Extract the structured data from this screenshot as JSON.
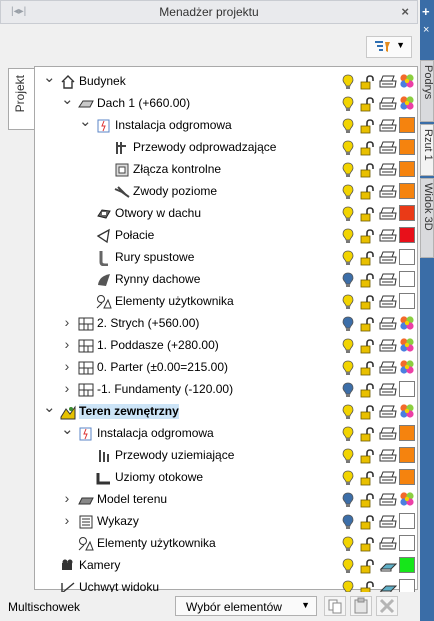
{
  "window": {
    "title": "Menadżer projektu"
  },
  "toolbar": {
    "filter_icon": "filter-icon",
    "dropdown_arrow": "▼"
  },
  "left_tab": {
    "label": "Projekt"
  },
  "right_tabs": [
    {
      "label": "Podrys"
    },
    {
      "label": "Rzut 1"
    },
    {
      "label": "Widok 3D"
    }
  ],
  "tree": {
    "rows": [
      {
        "label": "Budynek",
        "level": 0,
        "expand": "open",
        "icon": "house-icon",
        "bulb": "yellow",
        "print": "printer",
        "color": "multi"
      },
      {
        "label": "Dach 1 (+660.00)",
        "level": 1,
        "expand": "open",
        "icon": "roof-icon",
        "bulb": "yellow",
        "print": "printer",
        "color": "multi"
      },
      {
        "label": "Instalacja odgromowa",
        "level": 2,
        "expand": "open",
        "icon": "lightning-install-icon",
        "bulb": "yellow",
        "print": "printer",
        "color": "#f5830e"
      },
      {
        "label": "Przewody odprowadzające",
        "level": 3,
        "expand": "none",
        "icon": "down-conductor-icon",
        "bulb": "yellow",
        "print": "printer",
        "color": "#f5830e"
      },
      {
        "label": "Złącza kontrolne",
        "level": 3,
        "expand": "none",
        "icon": "test-joint-icon",
        "bulb": "yellow",
        "print": "printer",
        "color": "#f5830e"
      },
      {
        "label": "Zwody poziome",
        "level": 3,
        "expand": "none",
        "icon": "horizontal-conductor-icon",
        "bulb": "yellow",
        "print": "printer",
        "color": "#f5830e"
      },
      {
        "label": "Otwory w dachu",
        "level": 2,
        "expand": "none",
        "icon": "roof-opening-icon",
        "bulb": "yellow",
        "print": "printer",
        "color": "#ea3a17"
      },
      {
        "label": "Połacie",
        "level": 2,
        "expand": "none",
        "icon": "roof-slope-icon",
        "bulb": "yellow",
        "print": "printer",
        "color": "#e8101a"
      },
      {
        "label": "Rury spustowe",
        "level": 2,
        "expand": "none",
        "icon": "downpipe-icon",
        "bulb": "yellow",
        "print": "printer",
        "color": "#ffffff"
      },
      {
        "label": "Rynny dachowe",
        "level": 2,
        "expand": "none",
        "icon": "gutter-icon",
        "bulb": "blue",
        "print": "printer",
        "color": "#ffffff"
      },
      {
        "label": "Elementy użytkownika",
        "level": 2,
        "expand": "none",
        "icon": "user-elements-icon",
        "bulb": "yellow",
        "print": "printer",
        "color": "#ffffff"
      },
      {
        "label": "2. Strych (+560.00)",
        "level": 1,
        "expand": "closed",
        "icon": "storey-icon",
        "bulb": "blue",
        "print": "printer",
        "color": "multi"
      },
      {
        "label": "1. Poddasze (+280.00)",
        "level": 1,
        "expand": "closed",
        "icon": "storey-icon",
        "bulb": "yellow",
        "print": "printer",
        "color": "multi"
      },
      {
        "label": "0. Parter (±0.00=215.00)",
        "level": 1,
        "expand": "closed",
        "icon": "storey-icon",
        "bulb": "yellow",
        "print": "printer",
        "color": "multi"
      },
      {
        "label": "-1. Fundamenty (-120.00)",
        "level": 1,
        "expand": "closed",
        "icon": "storey-icon",
        "bulb": "blue",
        "print": "printer",
        "color": "#ffffff"
      },
      {
        "label": "Teren zewnętrzny",
        "level": 0,
        "expand": "open",
        "icon": "terrain-icon",
        "bulb": "yellow",
        "print": "printer",
        "color": "multi",
        "bold": true,
        "selected": true
      },
      {
        "label": "Instalacja odgromowa",
        "level": 1,
        "expand": "open",
        "icon": "lightning-install-icon",
        "bulb": "yellow",
        "print": "printer",
        "color": "#f5830e"
      },
      {
        "label": "Przewody uziemiające",
        "level": 2,
        "expand": "none",
        "icon": "earthing-conductor-icon",
        "bulb": "yellow",
        "print": "printer",
        "color": "#f5830e"
      },
      {
        "label": "Uziomy otokowe",
        "level": 2,
        "expand": "none",
        "icon": "ring-earth-icon",
        "bulb": "yellow",
        "print": "printer",
        "color": "#f5830e"
      },
      {
        "label": "Model terenu",
        "level": 1,
        "expand": "closed",
        "icon": "terrain-model-icon",
        "bulb": "blue",
        "print": "printer",
        "color": "multi"
      },
      {
        "label": "Wykazy",
        "level": 1,
        "expand": "closed",
        "icon": "list-icon",
        "bulb": "blue",
        "print": "printer",
        "color": "#ffffff"
      },
      {
        "label": "Elementy użytkownika",
        "level": 1,
        "expand": "none",
        "icon": "user-elements-icon",
        "bulb": "yellow",
        "print": "printer",
        "color": "#ffffff"
      },
      {
        "label": "Kamery",
        "level": 0,
        "expand": "none",
        "icon": "camera-icon",
        "bulb": "yellow",
        "print": "eraser",
        "color": "#16e61a"
      },
      {
        "label": "Uchwyt widoku",
        "level": 0,
        "expand": "none",
        "icon": "view-handle-icon",
        "bulb": "yellow",
        "print": "eraser",
        "color": "#ffffff"
      }
    ]
  },
  "status": {
    "label": "Multischowek",
    "dropdown": "Wybór elementów",
    "buttons": [
      "copy-icon",
      "paste-icon",
      "delete-icon"
    ]
  }
}
